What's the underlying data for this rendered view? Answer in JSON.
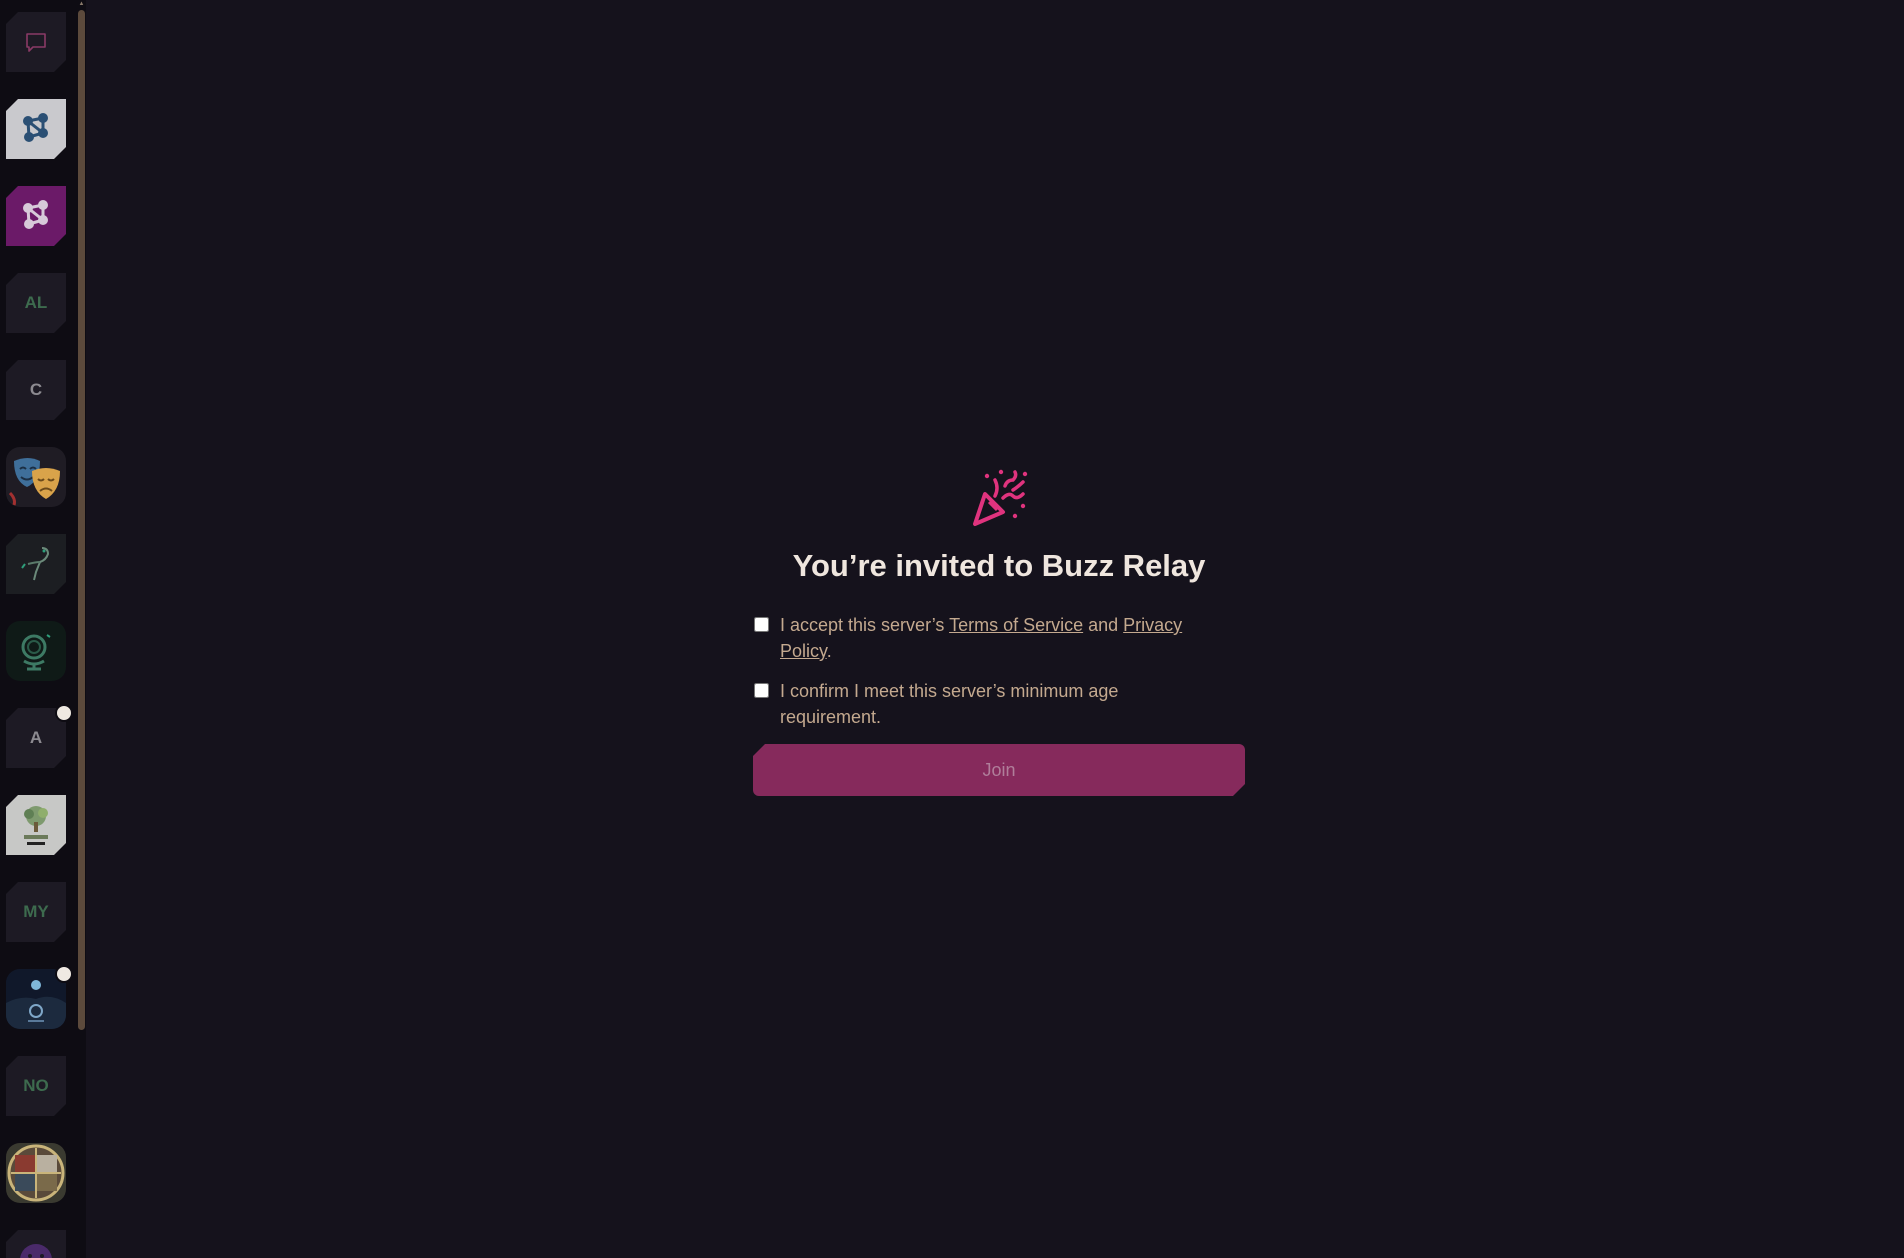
{
  "sidebar": {
    "servers": [
      {
        "id": "dm",
        "icon": "chat-bubble-icon"
      },
      {
        "id": "buzz-gray",
        "icon": "network-logo-icon"
      },
      {
        "id": "buzz-purple",
        "icon": "network-logo-icon"
      },
      {
        "id": "al",
        "abbr": "AL"
      },
      {
        "id": "c",
        "abbr": "C"
      },
      {
        "id": "theater",
        "icon": "theater-masks-icon"
      },
      {
        "id": "bird",
        "icon": "bird-icon"
      },
      {
        "id": "globe",
        "icon": "globe-icon"
      },
      {
        "id": "a",
        "abbr": "A"
      },
      {
        "id": "tree",
        "icon": "tree-logo-icon"
      },
      {
        "id": "my",
        "abbr": "MY"
      },
      {
        "id": "night",
        "icon": "night-scene-icon"
      },
      {
        "id": "no",
        "abbr": "NO"
      },
      {
        "id": "collage",
        "icon": "photo-collage-icon"
      },
      {
        "id": "smiley",
        "icon": "smiley-icon"
      }
    ]
  },
  "invite": {
    "icon": "party-popper-icon",
    "title": "You’re invited to Buzz Relay",
    "terms_prefix": "I accept this server’s ",
    "terms_link": "Terms of Service",
    "terms_and": " and ",
    "privacy_link": "Privacy Policy",
    "terms_suffix": ".",
    "age_text": "I confirm I meet this server’s minimum age requirement.",
    "join_label": "Join"
  },
  "colors": {
    "background": "#15121c",
    "sidebar": "#0e0c13",
    "accent": "#862a5c",
    "icon_pink": "#e0337e",
    "text": "#c4a98f",
    "title": "#efe6de"
  }
}
